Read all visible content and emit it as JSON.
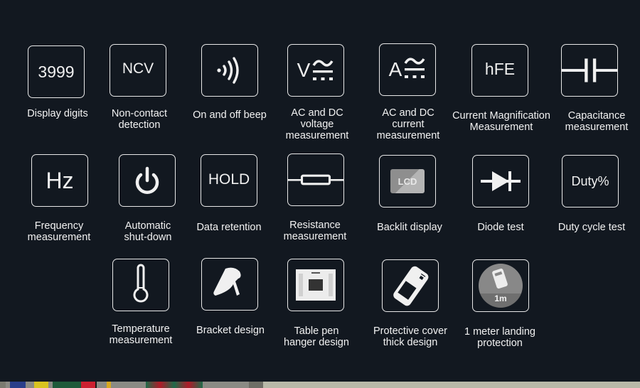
{
  "colors": {
    "background": "#121820",
    "box_border": "#e8e8e8",
    "text": "#f2f2f2"
  },
  "features": [
    {
      "id": "display-digits",
      "icon": "3999-text-icon",
      "icon_text": "3999",
      "label": "Display digits"
    },
    {
      "id": "ncv",
      "icon": "ncv-text-icon",
      "icon_text": "NCV",
      "label": "Non-contact\ndetection"
    },
    {
      "id": "beep",
      "icon": "sound-wave-icon",
      "label": "On and off beep"
    },
    {
      "id": "ac-dc-voltage",
      "icon": "ac-dc-voltage-icon",
      "icon_text": "V",
      "label": "AC and DC\nvoltage\nmeasurement"
    },
    {
      "id": "ac-dc-current",
      "icon": "ac-dc-current-icon",
      "icon_text": "A",
      "label": "AC and DC\ncurrent\nmeasurement"
    },
    {
      "id": "hfe",
      "icon": "hfe-text-icon",
      "icon_text": "hFE",
      "label": "Current Magnification\nMeasurement"
    },
    {
      "id": "capacitance",
      "icon": "capacitor-icon",
      "label": "Capacitance\nmeasurement"
    },
    {
      "id": "frequency",
      "icon": "hz-text-icon",
      "icon_text": "Hz",
      "label": "Frequency\nmeasurement"
    },
    {
      "id": "auto-shutdown",
      "icon": "power-icon",
      "label": "Automatic\nshut-down"
    },
    {
      "id": "data-retention",
      "icon": "hold-text-icon",
      "icon_text": "HOLD",
      "label": "Data retention"
    },
    {
      "id": "resistance",
      "icon": "resistor-icon",
      "label": "Resistance\nmeasurement"
    },
    {
      "id": "backlight",
      "icon": "lcd-icon",
      "icon_text": "LCD",
      "label": "Backlit display"
    },
    {
      "id": "diode",
      "icon": "diode-icon",
      "label": "Diode test"
    },
    {
      "id": "duty-cycle",
      "icon": "duty-text-icon",
      "icon_text": "Duty%",
      "label": "Duty cycle test"
    },
    {
      "id": "temperature",
      "icon": "thermometer-icon",
      "label": "Temperature\nmeasurement"
    },
    {
      "id": "bracket",
      "icon": "bracket-icon",
      "label": "Bracket design"
    },
    {
      "id": "pen-hanger",
      "icon": "pen-hanger-icon",
      "label": "Table pen\nhanger design"
    },
    {
      "id": "protective-cover",
      "icon": "protective-cover-icon",
      "label": "Protective cover\nthick design"
    },
    {
      "id": "drop-protection",
      "icon": "drop-1m-icon",
      "icon_text": "1m",
      "label": "1 meter landing\nprotection"
    }
  ]
}
